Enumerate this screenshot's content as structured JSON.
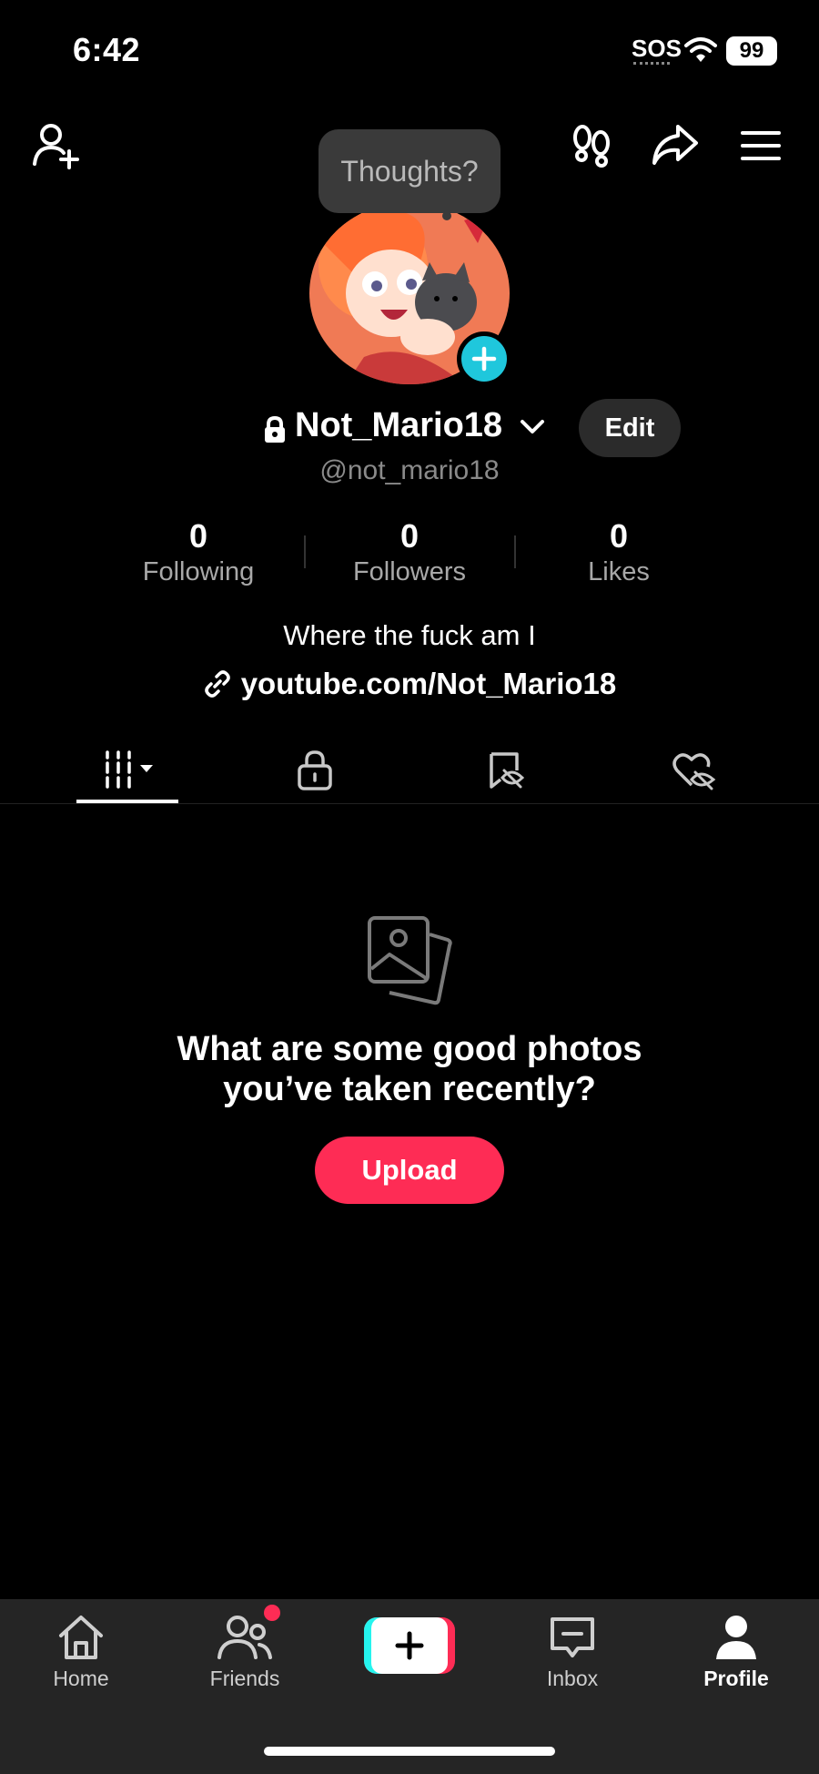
{
  "status_bar": {
    "time": "6:42",
    "sos": "SOS",
    "battery": "99"
  },
  "thoughts_bubble": "Thoughts?",
  "profile": {
    "name": "Not_Mario18",
    "handle": "@not_mario18",
    "edit_label": "Edit",
    "bio": "Where the fuck am I",
    "link": "youtube.com/Not_Mario18"
  },
  "stats": [
    {
      "value": "0",
      "label": "Following"
    },
    {
      "value": "0",
      "label": "Followers"
    },
    {
      "value": "0",
      "label": "Likes"
    }
  ],
  "empty_state": {
    "line1": "What are some good photos",
    "line2": "you’ve taken recently?",
    "button": "Upload"
  },
  "nav": {
    "home": "Home",
    "friends": "Friends",
    "inbox": "Inbox",
    "profile": "Profile"
  },
  "colors": {
    "accent": "#fe2c55",
    "cyan": "#1fc7dc",
    "nav_bg": "#252525"
  }
}
